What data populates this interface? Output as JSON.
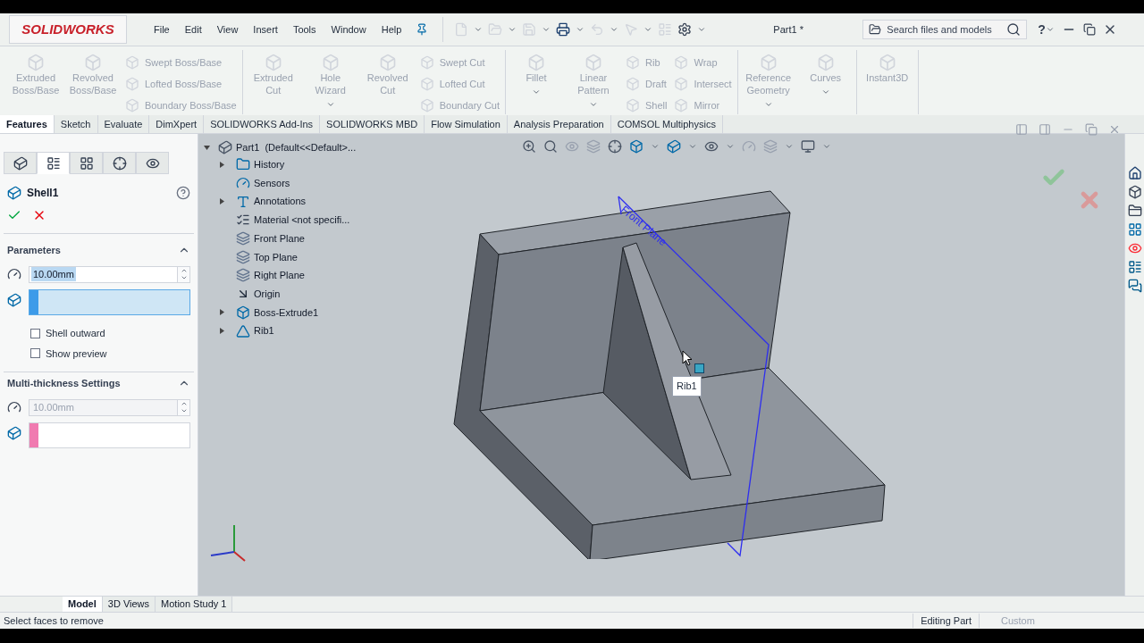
{
  "app": {
    "logo": "SOLIDWORKS",
    "menu": [
      "File",
      "Edit",
      "View",
      "Insert",
      "Tools",
      "Window",
      "Help"
    ],
    "document_title": "Part1 *",
    "search": {
      "placeholder": "Search files and models"
    },
    "help": "?"
  },
  "ribbon": {
    "groups": [
      {
        "items": [
          {
            "kind": "large",
            "label": "Extruded Boss/Base",
            "disabled": true,
            "has_menu": false
          },
          {
            "kind": "large",
            "label": "Revolved Boss/Base",
            "disabled": true,
            "has_menu": false
          },
          {
            "kind": "column",
            "items": [
              {
                "label": "Swept Boss/Base",
                "disabled": true
              },
              {
                "label": "Lofted Boss/Base",
                "disabled": true
              },
              {
                "label": "Boundary Boss/Base",
                "disabled": true
              }
            ]
          }
        ]
      },
      {
        "items": [
          {
            "kind": "large",
            "label": "Extruded Cut",
            "disabled": true,
            "has_menu": false
          },
          {
            "kind": "large",
            "label": "Hole Wizard",
            "disabled": true,
            "has_menu": true
          },
          {
            "kind": "large",
            "label": "Revolved Cut",
            "disabled": true,
            "has_menu": false
          },
          {
            "kind": "column",
            "items": [
              {
                "label": "Swept Cut",
                "disabled": true
              },
              {
                "label": "Lofted Cut",
                "disabled": true
              },
              {
                "label": "Boundary Cut",
                "disabled": true
              }
            ]
          }
        ]
      },
      {
        "items": [
          {
            "kind": "large",
            "label": "Fillet",
            "disabled": true,
            "has_menu": true
          },
          {
            "kind": "large",
            "label": "Linear Pattern",
            "disabled": true,
            "has_menu": true
          },
          {
            "kind": "column",
            "items": [
              {
                "label": "Rib",
                "disabled": true
              },
              {
                "label": "Draft",
                "disabled": true
              },
              {
                "label": "Shell",
                "disabled": true
              }
            ]
          },
          {
            "kind": "column",
            "items": [
              {
                "label": "Wrap",
                "disabled": true
              },
              {
                "label": "Intersect",
                "disabled": true
              },
              {
                "label": "Mirror",
                "disabled": true
              }
            ]
          }
        ]
      },
      {
        "items": [
          {
            "kind": "large",
            "label": "Reference Geometry",
            "disabled": true,
            "has_menu": true
          },
          {
            "kind": "large",
            "label": "Curves",
            "disabled": true,
            "has_menu": true
          }
        ]
      },
      {
        "items": [
          {
            "kind": "large",
            "label": "Instant3D",
            "disabled": true,
            "has_menu": false
          }
        ]
      }
    ]
  },
  "command_tabs": [
    {
      "label": "Features",
      "selected": true
    },
    {
      "label": "Sketch",
      "selected": false
    },
    {
      "label": "Evaluate",
      "selected": false
    },
    {
      "label": "DimXpert",
      "selected": false
    },
    {
      "label": "SOLIDWORKS Add-Ins",
      "selected": false
    },
    {
      "label": "SOLIDWORKS MBD",
      "selected": false
    },
    {
      "label": "Flow Simulation",
      "selected": false
    },
    {
      "label": "Analysis Preparation",
      "selected": false
    },
    {
      "label": "COMSOL Multiphysics",
      "selected": false
    }
  ],
  "panel_tabs": [
    {
      "selected": false
    },
    {
      "selected": true
    },
    {
      "selected": false
    },
    {
      "selected": false
    },
    {
      "selected": false
    }
  ],
  "property_manager": {
    "title": "Shell1",
    "parameters": {
      "title": "Parameters",
      "expanded": true,
      "thickness": {
        "value": "10.00mm",
        "value_selected": true,
        "disabled": false
      },
      "faces": {
        "active": true,
        "color": "#3d9be9"
      },
      "options": [
        {
          "label": "Shell outward",
          "checked": false
        },
        {
          "label": "Show preview",
          "checked": false
        }
      ]
    },
    "multi_thickness": {
      "title": "Multi-thickness Settings",
      "expanded": true,
      "thickness": {
        "value": "10.00mm",
        "value_selected": false,
        "disabled": true
      },
      "faces": {
        "active": false,
        "color": "#f07ab0"
      }
    }
  },
  "tree": {
    "root": "Part1  (Default<<Default>...",
    "expanded": true,
    "children": [
      {
        "label": "History",
        "kind": "folder",
        "collapsed": true
      },
      {
        "label": "Sensors",
        "kind": "sensor",
        "collapsed": false
      },
      {
        "label": "Annotations",
        "kind": "annotation",
        "collapsed": true
      },
      {
        "label": "Material <not specifi...",
        "kind": "material",
        "collapsed": false
      },
      {
        "label": "Front Plane",
        "kind": "plane",
        "collapsed": false
      },
      {
        "label": "Top Plane",
        "kind": "plane",
        "collapsed": false
      },
      {
        "label": "Right Plane",
        "kind": "plane",
        "collapsed": false
      },
      {
        "label": "Origin",
        "kind": "origin",
        "collapsed": false
      },
      {
        "label": "Boss-Extrude1",
        "kind": "extrude",
        "collapsed": true
      },
      {
        "label": "Rib1",
        "kind": "rib",
        "collapsed": true
      }
    ]
  },
  "viewport": {
    "plane_label": "Front Plane",
    "tooltip": "Rib1"
  },
  "bottom_tabs": [
    {
      "label": "Model",
      "selected": true
    },
    {
      "label": "3D Views",
      "selected": false
    },
    {
      "label": "Motion Study 1",
      "selected": false
    }
  ],
  "status_bar": {
    "message": "Select faces to remove",
    "mode": "Editing Part",
    "units": "Custom"
  }
}
